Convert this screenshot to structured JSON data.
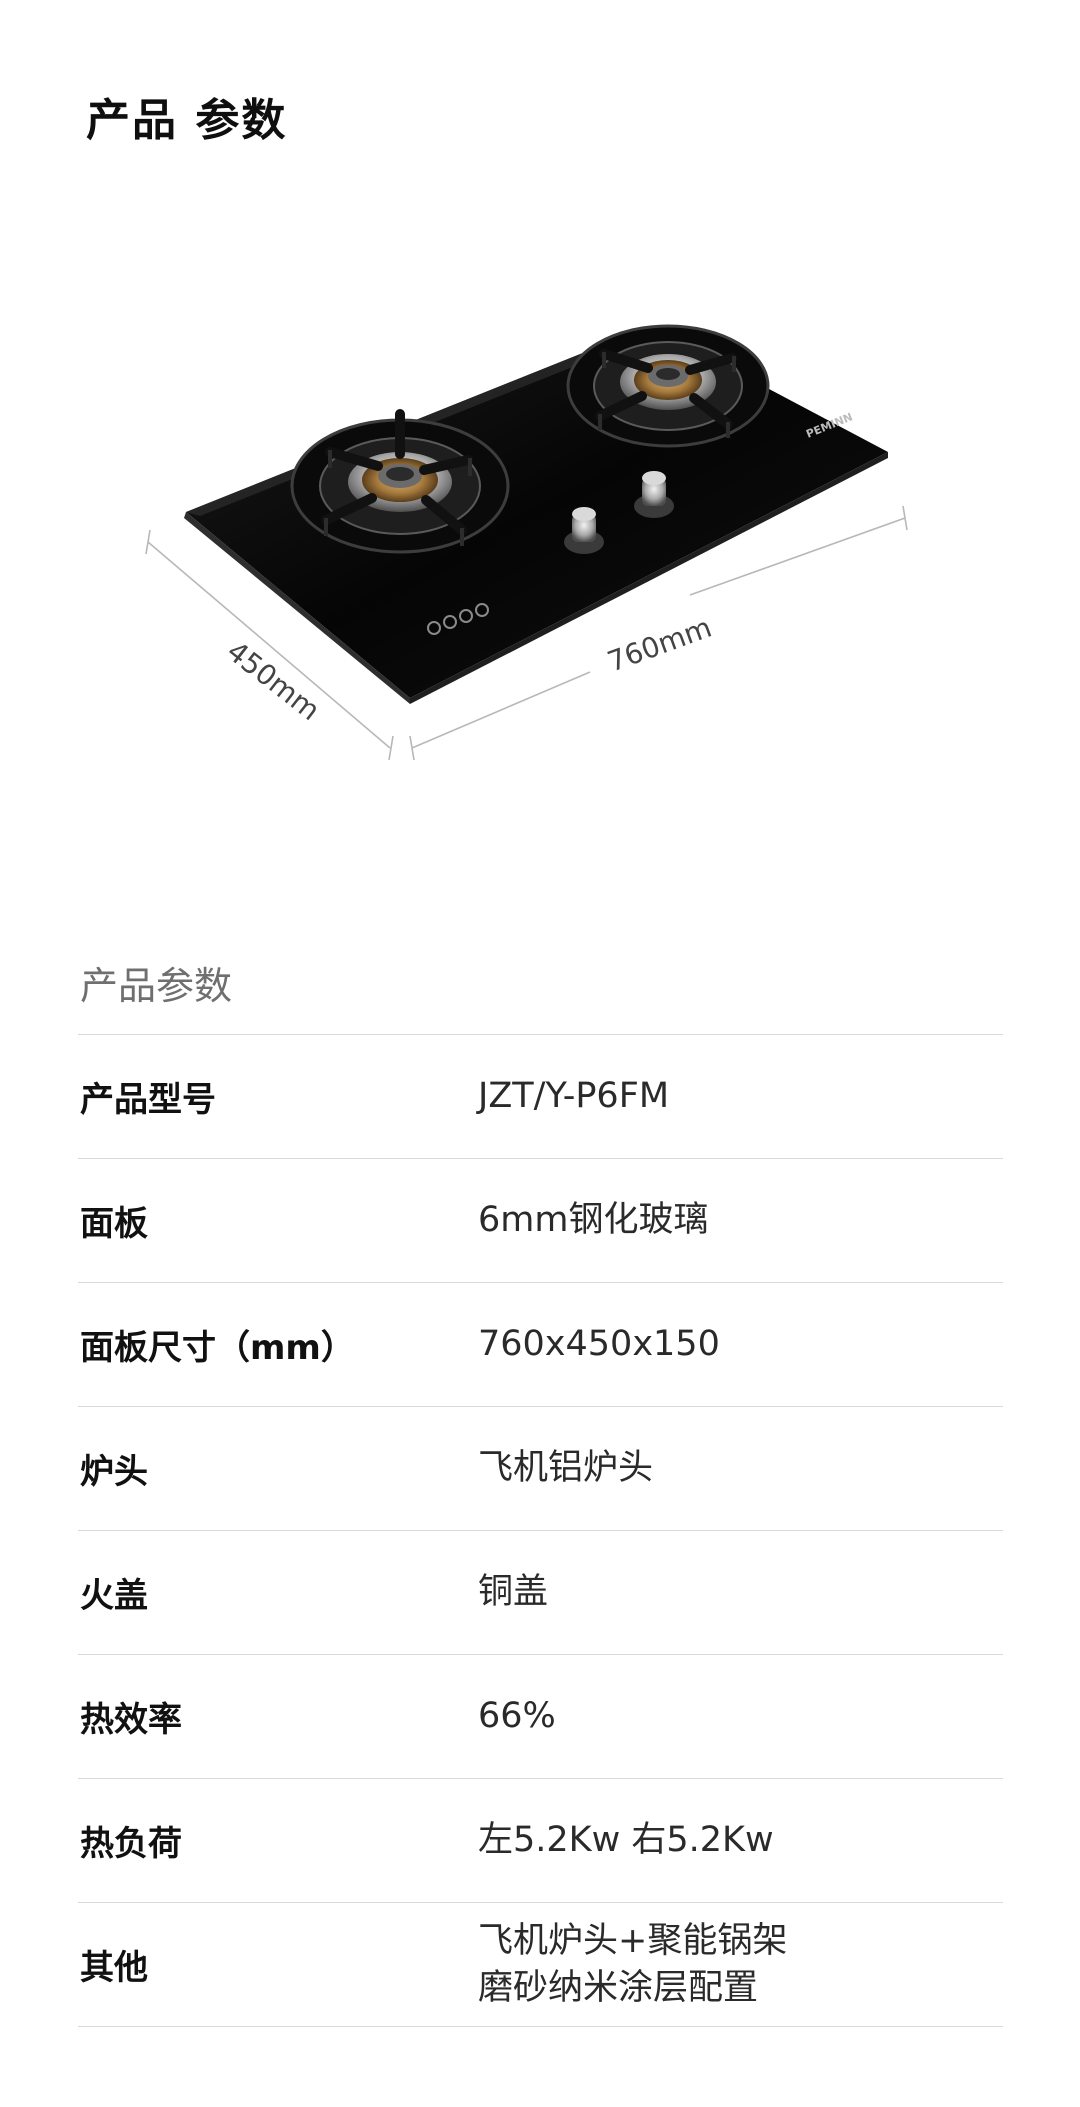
{
  "header": {
    "title": "产品 参数"
  },
  "figure": {
    "depth_label": "450mm",
    "width_label": "760mm",
    "brand_text": "PEMINN"
  },
  "specs": {
    "section_label": "产品参数",
    "rows": [
      {
        "name": "产品型号",
        "value": [
          "JZT/Y-P6FM"
        ]
      },
      {
        "name": "面板",
        "value": [
          "6mm钢化玻璃"
        ]
      },
      {
        "name": "面板尺寸（mm）",
        "value": [
          "760x450x150"
        ]
      },
      {
        "name": "炉头",
        "value": [
          "飞机铝炉头"
        ]
      },
      {
        "name": "火盖",
        "value": [
          "铜盖"
        ]
      },
      {
        "name": "热效率",
        "value": [
          "66%"
        ]
      },
      {
        "name": "热负荷",
        "value": [
          "左5.2Kw 右5.2Kw"
        ]
      },
      {
        "name": "其他",
        "value": [
          "飞机炉头+聚能锅架",
          "磨砂纳米涂层配置"
        ]
      }
    ]
  }
}
